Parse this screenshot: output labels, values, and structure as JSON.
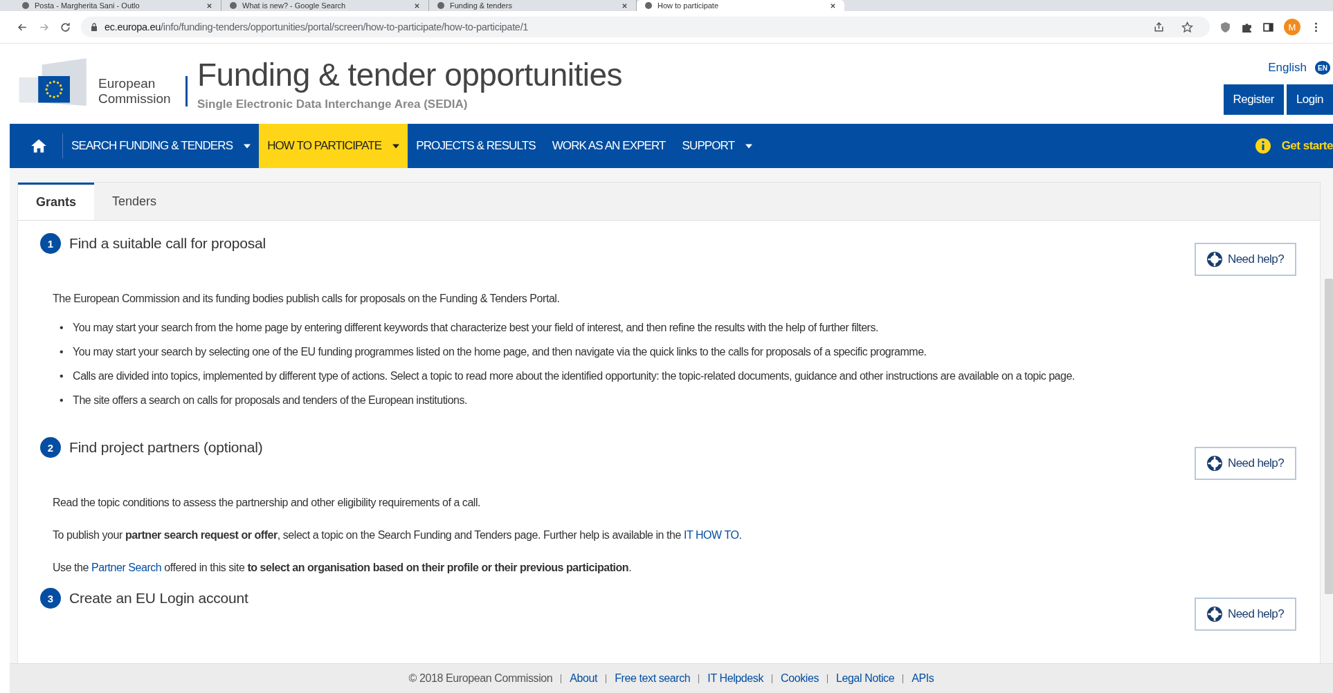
{
  "browser": {
    "tabs": [
      {
        "title": "Posta - Margherita Sani - Outlo",
        "selected": false
      },
      {
        "title": "What is new? - Google Search",
        "selected": false
      },
      {
        "title": "Funding & tenders",
        "selected": false
      },
      {
        "title": "How to participate",
        "selected": true
      }
    ],
    "url_host": "ec.europa.eu",
    "url_path": "/info/funding-tenders/opportunities/portal/screen/how-to-participate/how-to-participate/1",
    "avatar": "M"
  },
  "header": {
    "logo_text": "European Commission",
    "title": "Funding & tender opportunities",
    "subtitle": "Single Electronic Data Interchange Area (SEDIA)",
    "language": "English",
    "language_code": "EN",
    "buttons": [
      "Register",
      "Login"
    ]
  },
  "nav": {
    "items": [
      {
        "kind": "home",
        "selected": false
      },
      {
        "kind": "menu",
        "label": "SEARCH FUNDING & TENDERS",
        "dropdown": true,
        "selected": false
      },
      {
        "kind": "menu",
        "label": "HOW TO PARTICIPATE",
        "dropdown": true,
        "selected": true
      },
      {
        "kind": "menu",
        "label": "PROJECTS & RESULTS",
        "dropdown": false,
        "selected": false
      },
      {
        "kind": "menu",
        "label": "WORK AS AN EXPERT",
        "dropdown": false,
        "selected": false
      },
      {
        "kind": "menu",
        "label": "SUPPORT",
        "dropdown": true,
        "selected": false
      }
    ],
    "get_started": "Get starte"
  },
  "content_tabs": [
    {
      "label": "Grants",
      "selected": true
    },
    {
      "label": "Tenders",
      "selected": false
    }
  ],
  "sections": [
    {
      "number": "1",
      "title": "Find a suitable call for proposal",
      "help": "Need help?",
      "blocks": [
        {
          "kind": "text",
          "parts": [
            {
              "kind": "text",
              "text": "The European Commission and its funding bodies publish calls for proposals on the Funding & Tenders Portal."
            }
          ]
        },
        {
          "kind": "bullets",
          "marker": "•",
          "items": [
            "You may start your search from the home page by entering different keywords that characterize best your field of interest, and then refine the results with the help of further filters.",
            "You may start your search by selecting one of the EU funding programmes listed on the home page, and then navigate via the quick links to the calls for proposals of a specific programme.",
            "Calls are divided into topics, implemented by different type of actions. Select a topic to read more about the identified opportunity: the topic-related documents, guidance and other instructions are available on a topic page.",
            "The site offers a search on calls for proposals and tenders of the European institutions."
          ]
        }
      ]
    },
    {
      "number": "2",
      "title": "Find project partners (optional)",
      "help": "Need help?",
      "blocks": [
        {
          "kind": "text",
          "parts": [
            {
              "kind": "text",
              "text": "Read the topic conditions to assess the partnership and other eligibility requirements of a call."
            }
          ]
        },
        {
          "kind": "text",
          "parts": [
            {
              "kind": "text",
              "text": "To publish your **partner search request or offer**, select a topic on the Search Funding and Tenders page. Further help is available in the "
            },
            {
              "kind": "link",
              "text": "IT HOW TO"
            },
            {
              "kind": "text",
              "text": "."
            }
          ]
        },
        {
          "kind": "text",
          "parts": [
            {
              "kind": "text",
              "text": "Use the "
            },
            {
              "kind": "link",
              "text": "Partner Search"
            },
            {
              "kind": "text",
              "text": " offered in this site **to select an organisation based on their profile or their previous participation**."
            }
          ]
        }
      ]
    },
    {
      "number": "3",
      "title": "Create an EU Login account",
      "help": "Need help?"
    }
  ],
  "footer": {
    "copyright": "© 2018 European Commission",
    "links": [
      "About",
      "Free text search",
      "IT Helpdesk",
      "Cookies",
      "Legal Notice",
      "APIs"
    ]
  }
}
